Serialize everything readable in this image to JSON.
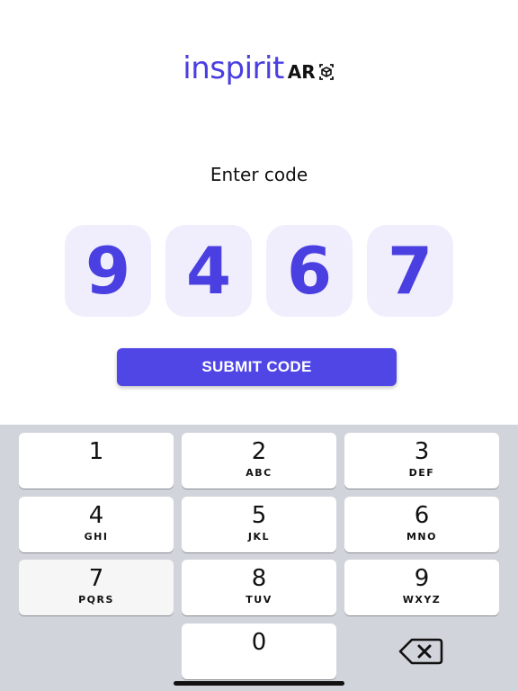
{
  "logo": {
    "main": "inspirit",
    "suffix": "AR"
  },
  "prompt": "Enter code",
  "code_digits": [
    "9",
    "4",
    "6",
    "7"
  ],
  "submit_label": "SUBMIT CODE",
  "keypad": {
    "keys": [
      {
        "num": "1",
        "letters": ""
      },
      {
        "num": "2",
        "letters": "ABC"
      },
      {
        "num": "3",
        "letters": "DEF"
      },
      {
        "num": "4",
        "letters": "GHI"
      },
      {
        "num": "5",
        "letters": "JKL"
      },
      {
        "num": "6",
        "letters": "MNO"
      },
      {
        "num": "7",
        "letters": "PQRS"
      },
      {
        "num": "8",
        "letters": "TUV"
      },
      {
        "num": "9",
        "letters": "WXYZ"
      },
      {
        "num": "0",
        "letters": ""
      }
    ],
    "delete_icon": "backspace-icon"
  },
  "colors": {
    "brand": "#4a3fe0",
    "button": "#4f46e5",
    "code_box_bg": "#f0eefc",
    "keyboard_bg": "#d1d4da"
  }
}
